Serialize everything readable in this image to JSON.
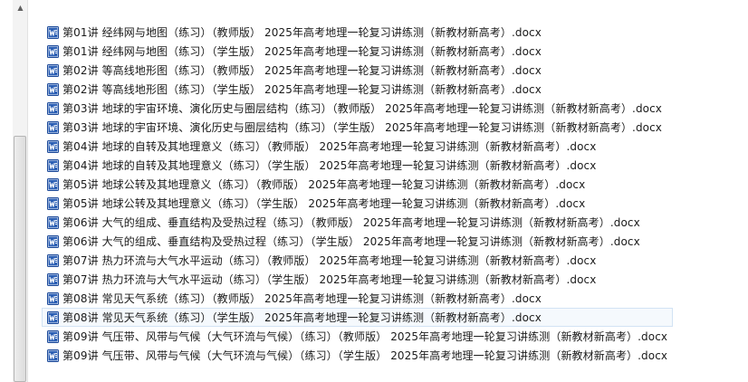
{
  "scrollbar": {
    "up_arrow": "▲"
  },
  "files": [
    {
      "name": "第01讲 经纬网与地图（练习）（教师版） 2025年高考地理一轮复习讲练测（新教材新高考）.docx",
      "icon": "word-doc-icon"
    },
    {
      "name": "第01讲 经纬网与地图（练习）（学生版） 2025年高考地理一轮复习讲练测（新教材新高考）.docx",
      "icon": "word-doc-icon"
    },
    {
      "name": "第02讲 等高线地形图（练习）（教师版） 2025年高考地理一轮复习讲练测（新教材新高考）.docx",
      "icon": "word-doc-icon"
    },
    {
      "name": "第02讲 等高线地形图（练习）（学生版） 2025年高考地理一轮复习讲练测（新教材新高考）.docx",
      "icon": "word-doc-icon"
    },
    {
      "name": "第03讲 地球的宇宙环境、演化历史与圈层结构（练习）（教师版） 2025年高考地理一轮复习讲练测（新教材新高考）.docx",
      "icon": "word-doc-icon"
    },
    {
      "name": "第03讲 地球的宇宙环境、演化历史与圈层结构（练习）（学生版） 2025年高考地理一轮复习讲练测（新教材新高考）.docx",
      "icon": "word-doc-icon"
    },
    {
      "name": "第04讲 地球的自转及其地理意义（练习）（教师版） 2025年高考地理一轮复习讲练测（新教材新高考）.docx",
      "icon": "word-doc-icon"
    },
    {
      "name": "第04讲 地球的自转及其地理意义（练习）（学生版） 2025年高考地理一轮复习讲练测（新教材新高考）.docx",
      "icon": "word-doc-icon"
    },
    {
      "name": "第05讲 地球公转及其地理意义（练习）（教师版） 2025年高考地理一轮复习讲练测（新教材新高考）.docx",
      "icon": "word-doc-icon"
    },
    {
      "name": "第05讲 地球公转及其地理意义（练习）（学生版） 2025年高考地理一轮复习讲练测（新教材新高考）.docx",
      "icon": "word-doc-icon"
    },
    {
      "name": "第06讲 大气的组成、垂直结构及受热过程（练习）（教师版） 2025年高考地理一轮复习讲练测（新教材新高考）.docx",
      "icon": "word-doc-icon"
    },
    {
      "name": "第06讲 大气的组成、垂直结构及受热过程（练习）（学生版） 2025年高考地理一轮复习讲练测（新教材新高考）.docx",
      "icon": "word-doc-icon"
    },
    {
      "name": "第07讲 热力环流与大气水平运动（练习）（教师版） 2025年高考地理一轮复习讲练测（新教材新高考）.docx",
      "icon": "word-doc-icon"
    },
    {
      "name": "第07讲 热力环流与大气水平运动（练习）（学生版） 2025年高考地理一轮复习讲练测（新教材新高考）.docx",
      "icon": "word-doc-icon"
    },
    {
      "name": "第08讲 常见天气系统（练习）（教师版） 2025年高考地理一轮复习讲练测（新教材新高考）.docx",
      "icon": "word-doc-icon"
    },
    {
      "name": "第08讲 常见天气系统（练习）（学生版） 2025年高考地理一轮复习讲练测（新教材新高考）.docx",
      "icon": "word-doc-icon",
      "hover": true
    },
    {
      "name": "第09讲 气压带、风带与气候（大气环流与气候）（练习）（教师版） 2025年高考地理一轮复习讲练测（新教材新高考）.docx",
      "icon": "word-doc-icon"
    },
    {
      "name": "第09讲 气压带、风带与气候（大气环流与气候）（练习）（学生版） 2025年高考地理一轮复习讲练测（新教材新高考）.docx",
      "icon": "word-doc-icon"
    }
  ],
  "colors": {
    "icon_blue": "#2b5fb4",
    "icon_dark": "#1d4a99",
    "hover_bg": "#f5f9fd",
    "hover_border": "#d2e3f4",
    "text": "#1a1a1a"
  }
}
